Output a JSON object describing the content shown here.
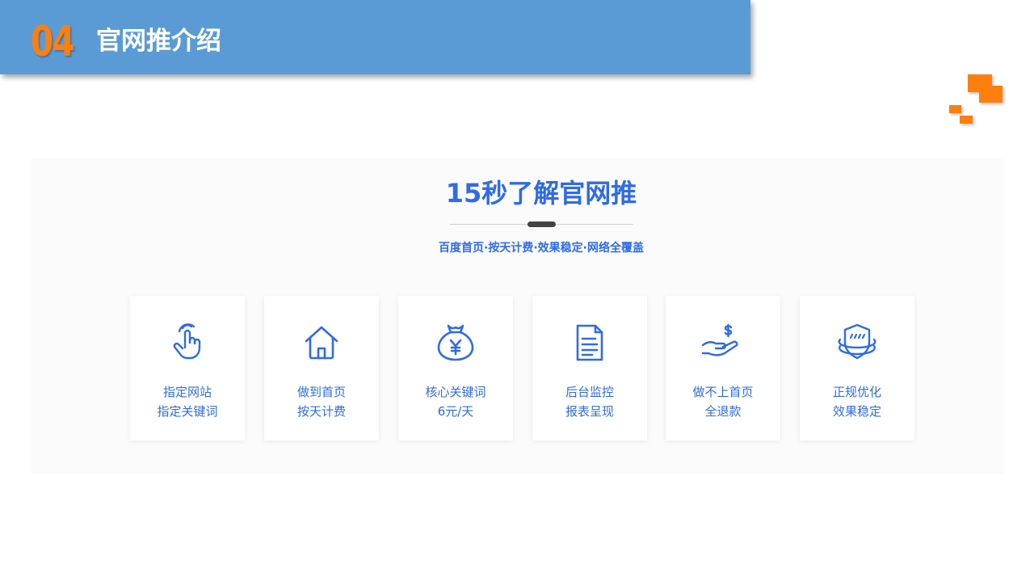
{
  "header": {
    "section_number": "04",
    "title": "官网推介绍"
  },
  "colors": {
    "header_bg": "#5b9bd5",
    "accent_orange": "#ff7f0e",
    "brand_blue": "#2f6be8"
  },
  "panel": {
    "heading": "15秒了解官网推",
    "subtitle": "百度首页·按天计费·效果稳定·网络全覆盖"
  },
  "features": [
    {
      "icon": "pointer-hand-icon",
      "line1": "指定网站",
      "line2": "指定关键词"
    },
    {
      "icon": "home-icon",
      "line1": "做到首页",
      "line2": "按天计费"
    },
    {
      "icon": "money-bag-icon",
      "line1": "核心关键词",
      "line2": "6元/天"
    },
    {
      "icon": "document-icon",
      "line1": "后台监控",
      "line2": "报表呈现"
    },
    {
      "icon": "hand-dollar-icon",
      "line1": "做不上首页",
      "line2": "全退款"
    },
    {
      "icon": "shield-icon",
      "line1": "正规优化",
      "line2": "效果稳定"
    }
  ]
}
